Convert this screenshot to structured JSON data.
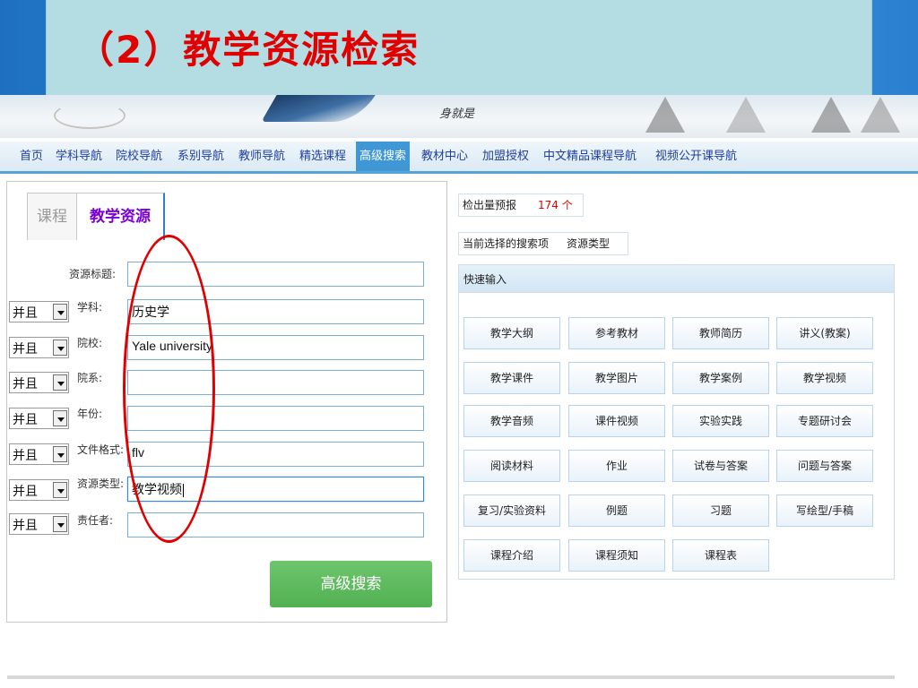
{
  "slide": {
    "title": "（2）教学资源检索"
  },
  "banner": {
    "text": "身就是"
  },
  "nav": {
    "items": [
      "首页",
      "学科导航",
      "院校导航",
      "系别导航",
      "教师导航",
      "精选课程",
      "高级搜索",
      "教材中心",
      "加盟授权",
      "中文精品课程导航",
      "视频公开课导航"
    ],
    "active_index": 6
  },
  "tabs": {
    "course": "课程",
    "resource": "教学资源"
  },
  "form": {
    "title_label": "资源标题:",
    "title_value": "",
    "rows": [
      {
        "op": "并且",
        "label": "学科:",
        "value": "历史学"
      },
      {
        "op": "并且",
        "label": "院校:",
        "value": "Yale university"
      },
      {
        "op": "并且",
        "label": "院系:",
        "value": ""
      },
      {
        "op": "并且",
        "label": "年份:",
        "value": ""
      },
      {
        "op": "并且",
        "label": "文件格式:",
        "value": "flv"
      },
      {
        "op": "并且",
        "label": "资源类型:",
        "value": "教学视频"
      },
      {
        "op": "并且",
        "label": "责任者:",
        "value": ""
      }
    ],
    "search_button": "高级搜索"
  },
  "stats": {
    "forecast_label": "检出量预报",
    "forecast_value": "174 个",
    "current_label": "当前选择的搜索项",
    "current_value": "资源类型"
  },
  "quick": {
    "header": "快速输入",
    "buttons": [
      [
        "教学大纲",
        "参考教材",
        "教师简历",
        "讲义(教案)"
      ],
      [
        "教学课件",
        "教学图片",
        "教学案例",
        "教学视频"
      ],
      [
        "教学音频",
        "课件视频",
        "实验实践",
        "专题研讨会"
      ],
      [
        "阅读材料",
        "作业",
        "试卷与答案",
        "问题与答案"
      ],
      [
        "复习/实验资料",
        "例题",
        "习题",
        "写绘型/手稿"
      ],
      [
        "课程介绍",
        "课程须知",
        "课程表"
      ]
    ]
  },
  "colors": {
    "title_red": "#e00000",
    "nav_active": "#3f97d6",
    "search_green": "#5cb85c",
    "tab_active": "#7b00d4"
  }
}
